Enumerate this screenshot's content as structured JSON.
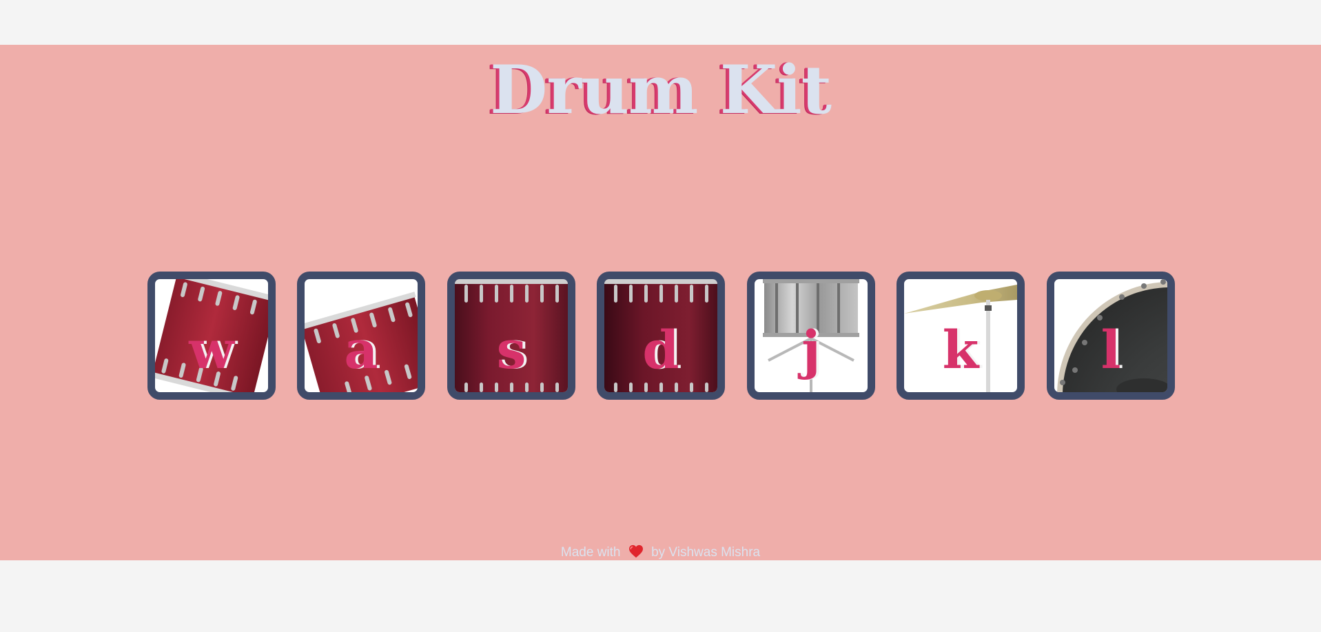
{
  "header": {
    "title": "Drum Kit"
  },
  "drums": [
    {
      "key": "w",
      "icon": "tom1-drum-icon"
    },
    {
      "key": "a",
      "icon": "tom2-drum-icon"
    },
    {
      "key": "s",
      "icon": "tom3-drum-icon"
    },
    {
      "key": "d",
      "icon": "tom4-drum-icon"
    },
    {
      "key": "j",
      "icon": "snare-drum-icon"
    },
    {
      "key": "k",
      "icon": "crash-cymbal-icon"
    },
    {
      "key": "l",
      "icon": "kick-drum-icon"
    }
  ],
  "footer": {
    "made_with": "Made with",
    "by": "by Vishwas Mishra",
    "icon": "heart-icon"
  },
  "colors": {
    "background": "#efaeaa",
    "page": "#f4f4f4",
    "title": "#dbe2ef",
    "accent": "#d7326a",
    "frame": "#404b69"
  }
}
